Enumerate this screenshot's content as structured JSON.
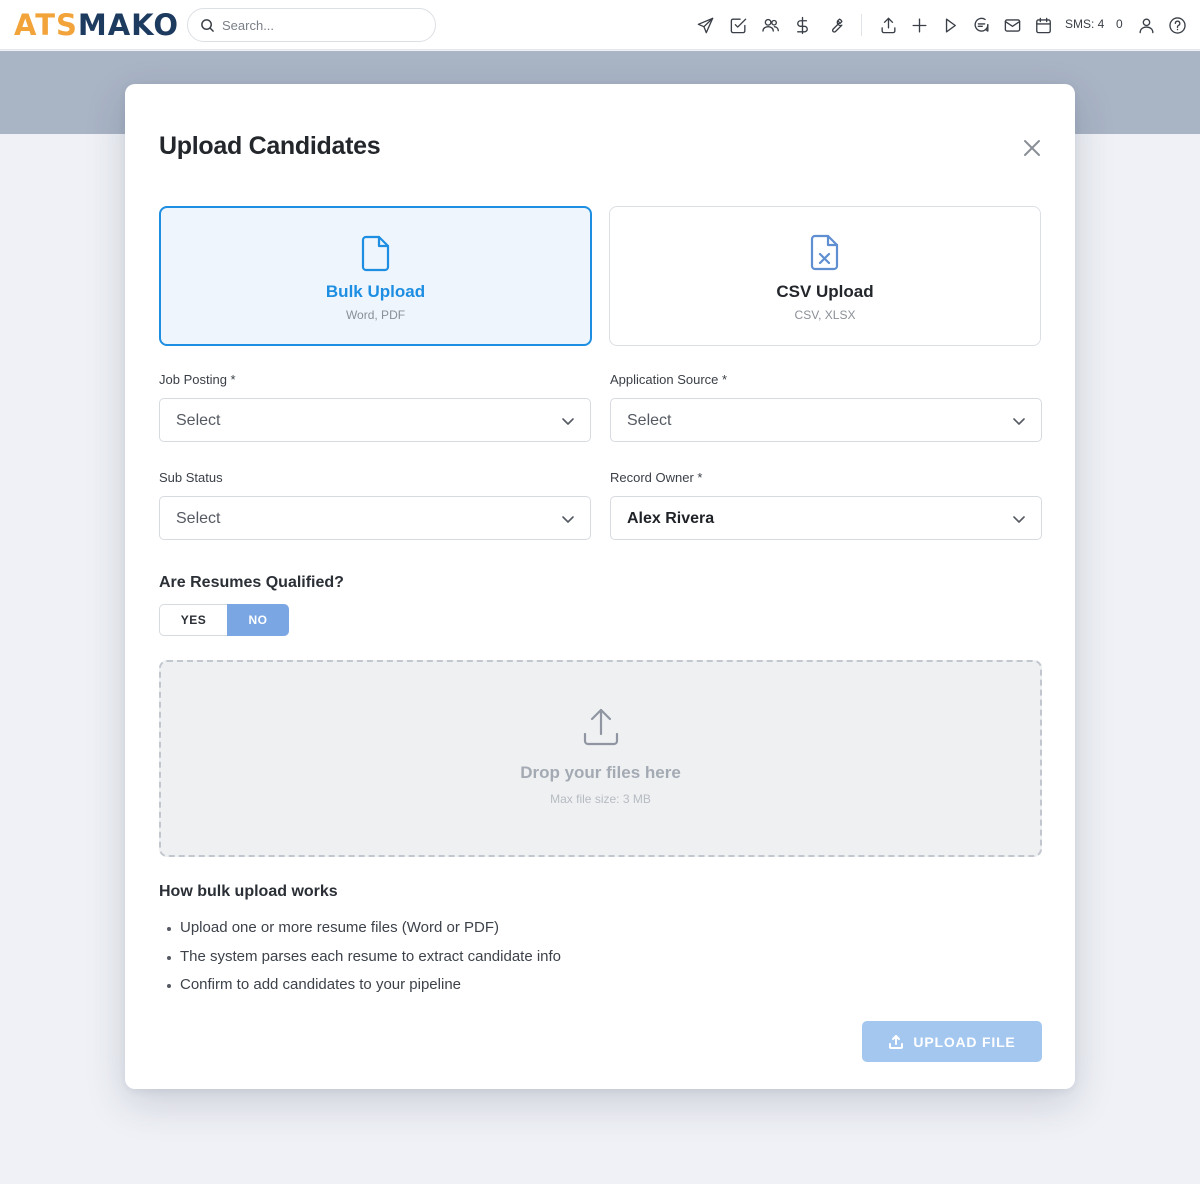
{
  "app": {
    "logo_part1": "ATS",
    "logo_part2": "MAKO",
    "brand_colors": {
      "ats": "#f2a33a",
      "mako": "#1d3a5f"
    }
  },
  "search": {
    "placeholder": "Search..."
  },
  "topbar": {
    "icons": [
      "send-icon",
      "task-check-icon",
      "users-icon",
      "dollar-icon",
      "wrench-icon",
      "upload-icon",
      "plus-icon",
      "play-icon",
      "chat-icon",
      "mail-icon",
      "calendar-icon",
      "user-icon",
      "help-icon"
    ],
    "sms_label": "SMS: 4",
    "notification_count": "0"
  },
  "modal": {
    "title": "Upload Candidates",
    "upload_types": [
      {
        "title": "Bulk Upload",
        "subtitle": "Word, PDF",
        "selected": true,
        "icon": "file-icon"
      },
      {
        "title": "CSV Upload",
        "subtitle": "CSV, XLSX",
        "selected": false,
        "icon": "spreadsheet-file-icon"
      }
    ],
    "fields": {
      "job_posting": {
        "label": "Job Posting *",
        "value": "Select"
      },
      "application_source": {
        "label": "Application Source *",
        "value": "Select"
      },
      "sub_status": {
        "label": "Sub Status",
        "value": "Select"
      },
      "record_owner": {
        "label": "Record Owner *",
        "value": "Alex Rivera"
      }
    },
    "qualified": {
      "question": "Are Resumes Qualified?",
      "yes_label": "YES",
      "no_label": "NO",
      "selected": "NO"
    },
    "dropzone": {
      "title": "Drop your files here",
      "subtitle": "Max file size: 3 MB"
    },
    "how_it_works": {
      "title": "How bulk upload works",
      "steps": [
        "Upload one or more resume files (Word or PDF)",
        "The system parses each resume to extract candidate info",
        "Confirm to add candidates to your pipeline"
      ]
    },
    "upload_button_label": "UPLOAD FILE",
    "accent_color": "#1d8ee2"
  }
}
